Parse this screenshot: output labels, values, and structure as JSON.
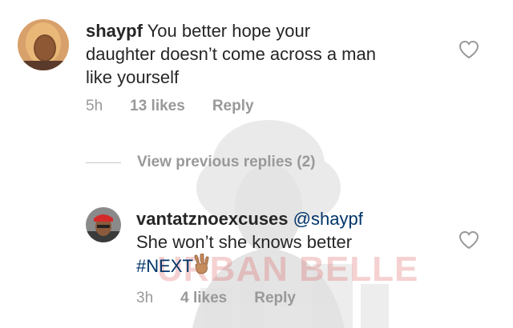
{
  "watermark": {
    "text": "URBAN BELLE"
  },
  "comment1": {
    "username": "shaypf",
    "text": "You better hope your daughter doesn’t come across a man like yourself",
    "line1": "You better hope your",
    "line2": "daughter doesn’t come across a man",
    "line3": "like yourself",
    "time": "5h",
    "likes": "13 likes",
    "reply_label": "Reply",
    "avatar_icon": "avatar-photo"
  },
  "view_replies": {
    "label": "View previous replies (2)"
  },
  "reply1": {
    "username": "vantatznoexcuses",
    "mention": "@shaypf",
    "text": "She won’t she knows better",
    "hashtag": "#NEXT",
    "emoji_icon": "victory-hand-icon",
    "time": "3h",
    "likes": "4 likes",
    "reply_label": "Reply",
    "avatar_icon": "avatar-photo"
  },
  "colors": {
    "text": "#262626",
    "meta": "#999999",
    "link": "#003569",
    "heart_stroke": "#999999"
  }
}
